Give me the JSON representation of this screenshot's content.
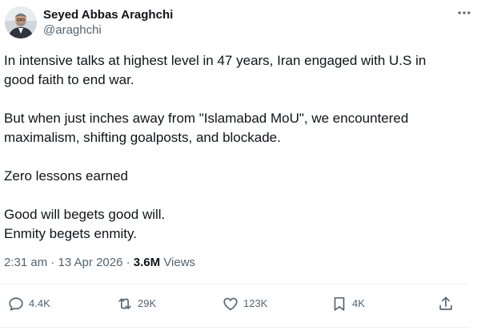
{
  "author": {
    "display_name": "Seyed Abbas Araghchi",
    "handle": "@araghchi"
  },
  "tweet": {
    "paragraphs": [
      [
        "In intensive talks at highest level in 47 years, Iran engaged with U.S in",
        "good faith to end war."
      ],
      [
        "But when just inches away from \"Islamabad MoU\", we encountered",
        "maximalism, shifting goalposts, and blockade."
      ],
      [
        "Zero lessons earned"
      ],
      [
        "Good will begets good will.",
        "Enmity begets enmity."
      ]
    ],
    "timestamp": "2:31 am · 13 Apr 2026",
    "views_count": "3.6M",
    "views_label": "Views"
  },
  "actions": {
    "replies": "4.4K",
    "reposts": "29K",
    "likes": "123K",
    "bookmarks": "4K"
  },
  "icons": {
    "more": "more-horizontal-icon",
    "reply": "reply-icon",
    "repost": "repost-icon",
    "like": "heart-icon",
    "bookmark": "bookmark-icon",
    "share": "share-icon"
  },
  "colors": {
    "text": "#0f1419",
    "secondary": "#536471",
    "divider": "#eff3f4"
  }
}
